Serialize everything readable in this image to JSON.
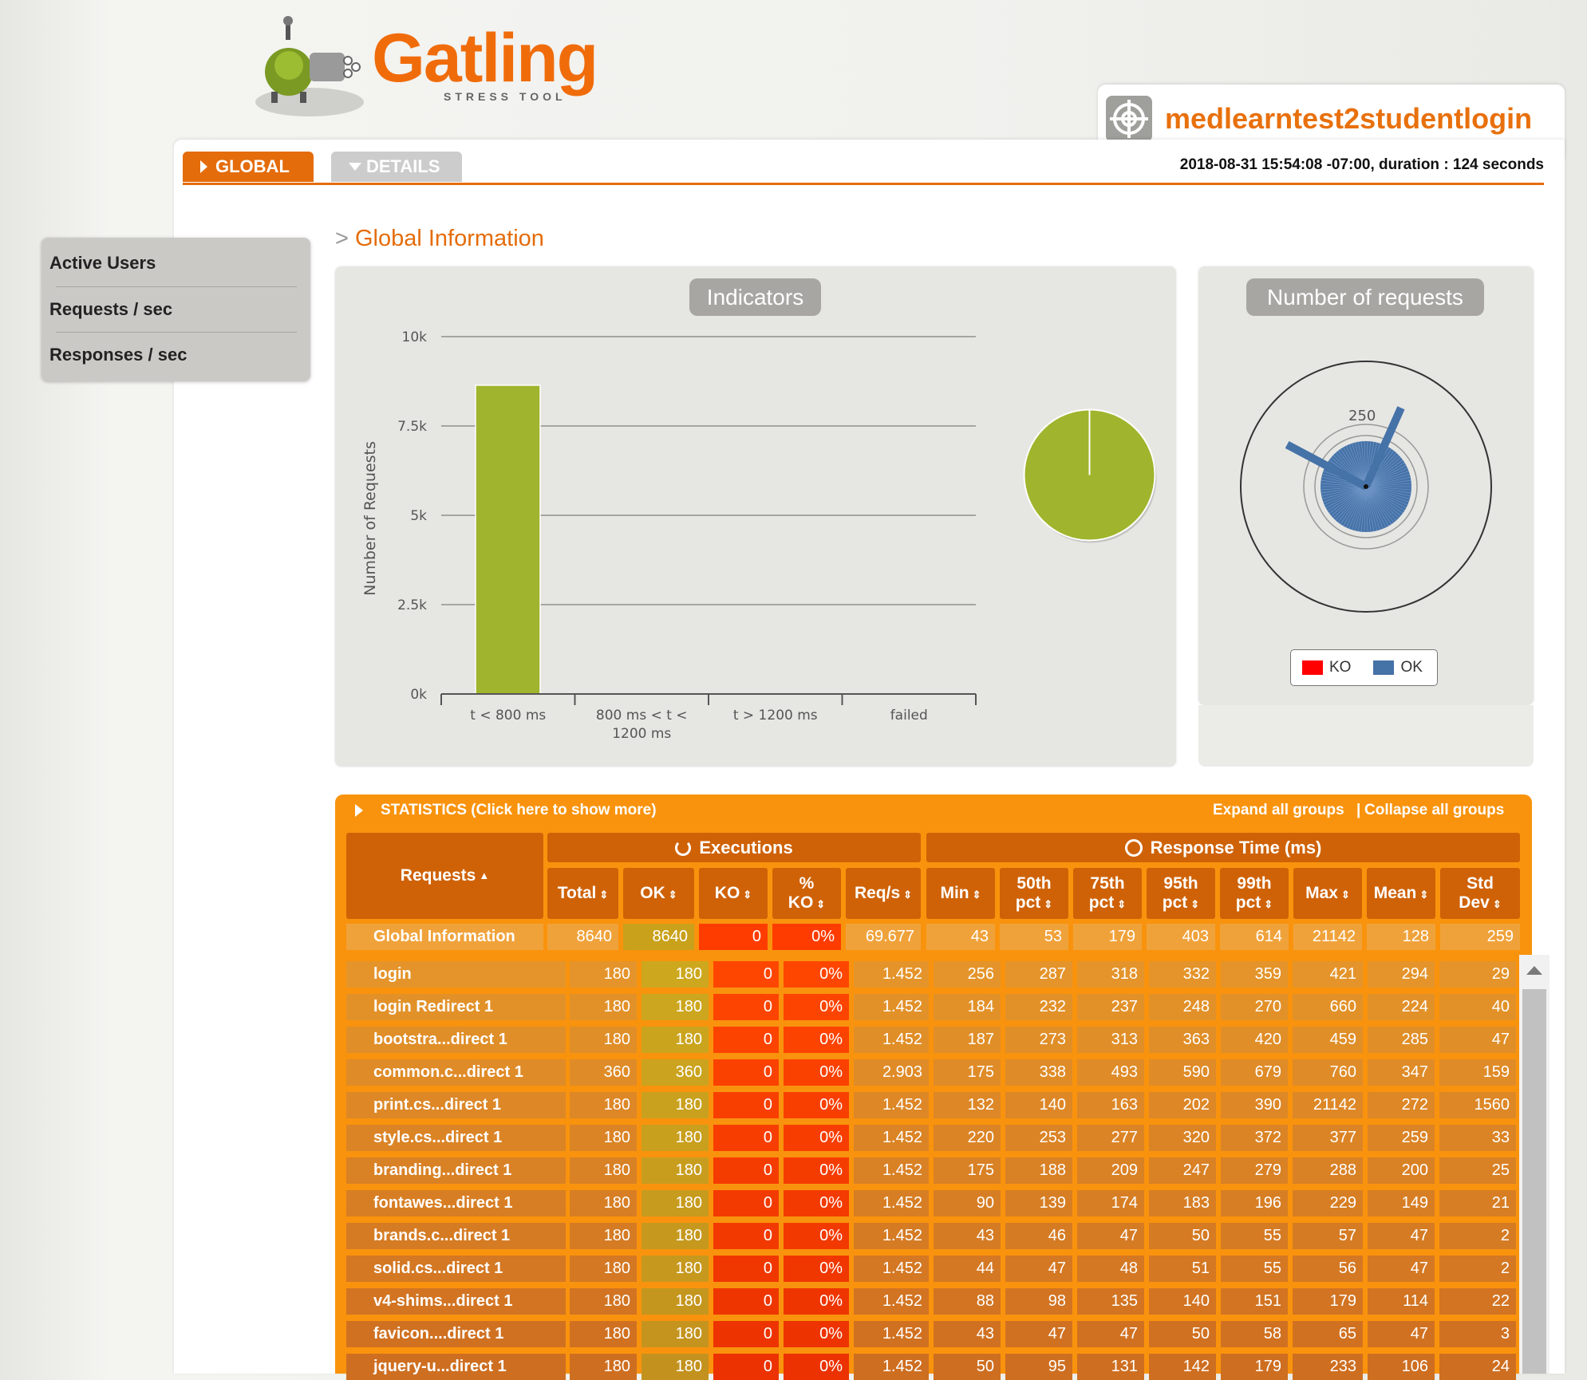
{
  "logo": {
    "word": "Gatling",
    "tagline": "STRESS TOOL"
  },
  "simulation": {
    "name": "medlearntest2studentlogin",
    "run_info": "2018-08-31 15:54:08 -07:00, duration : 124 seconds"
  },
  "tabs": {
    "global": "GLOBAL",
    "details": "DETAILS"
  },
  "menu": {
    "items": [
      "Active Users",
      "Requests / sec",
      "Responses / sec"
    ]
  },
  "section_title": "Global Information",
  "indicators": {
    "title": "Indicators",
    "chart_data": {
      "type": "bar",
      "categories": [
        "t < 800 ms",
        "800 ms < t < 1200 ms",
        "t > 1200 ms",
        "failed"
      ],
      "category_lines": [
        [
          "t < 800 ms"
        ],
        [
          "800 ms < t <",
          "1200 ms"
        ],
        [
          "t > 1200 ms"
        ],
        [
          "failed"
        ]
      ],
      "values": [
        8640,
        0,
        0,
        0
      ],
      "ylabel": "Number of Requests",
      "yticks": [
        "0k",
        "2.5k",
        "5k",
        "7.5k",
        "10k"
      ],
      "ylim": [
        0,
        10000
      ],
      "color": "#a0b52d",
      "grid": true
    },
    "pie": {
      "type": "pie",
      "slices": [
        {
          "label": "t < 800 ms",
          "value": 8640,
          "color": "#a0b52d"
        },
        {
          "label": "800 ms < t < 1200 ms",
          "value": 0,
          "color": "#f5d60a"
        },
        {
          "label": "t > 1200 ms",
          "value": 0,
          "color": "#ff9916"
        },
        {
          "label": "failed",
          "value": 0,
          "color": "#ff0000"
        }
      ]
    }
  },
  "requests_chart": {
    "title": "Number of requests",
    "ring_label": "250",
    "legend": [
      {
        "label": "KO",
        "color": "#ff0000"
      },
      {
        "label": "OK",
        "color": "#4572a7"
      }
    ]
  },
  "statistics": {
    "toggle_label": "STATISTICS (Click here to show more)",
    "expand_label": "Expand all groups",
    "separator": "|",
    "collapse_label": "Collapse all groups",
    "groups": {
      "executions": "Executions",
      "response_time": "Response Time (ms)"
    },
    "headers": {
      "requests": "Requests",
      "total": "Total",
      "ok": "OK",
      "ko": "KO",
      "pct_ko_1": "%",
      "pct_ko_2": "KO",
      "reqs": "Req/s",
      "min": "Min",
      "p50_1": "50th",
      "p50_2": "pct",
      "p75_1": "75th",
      "p75_2": "pct",
      "p95_1": "95th",
      "p95_2": "pct",
      "p99_1": "99th",
      "p99_2": "pct",
      "max": "Max",
      "mean": "Mean",
      "std_1": "Std",
      "std_2": "Dev"
    },
    "global_row": [
      "Global Information",
      "8640",
      "8640",
      "0",
      "0%",
      "69.677",
      "43",
      "53",
      "179",
      "403",
      "614",
      "21142",
      "128",
      "259"
    ],
    "rows": [
      [
        "login",
        "180",
        "180",
        "0",
        "0%",
        "1.452",
        "256",
        "287",
        "318",
        "332",
        "359",
        "421",
        "294",
        "29"
      ],
      [
        "login Redirect 1",
        "180",
        "180",
        "0",
        "0%",
        "1.452",
        "184",
        "232",
        "237",
        "248",
        "270",
        "660",
        "224",
        "40"
      ],
      [
        "bootstra...direct 1",
        "180",
        "180",
        "0",
        "0%",
        "1.452",
        "187",
        "273",
        "313",
        "363",
        "420",
        "459",
        "285",
        "47"
      ],
      [
        "common.c...direct 1",
        "360",
        "360",
        "0",
        "0%",
        "2.903",
        "175",
        "338",
        "493",
        "590",
        "679",
        "760",
        "347",
        "159"
      ],
      [
        "print.cs...direct 1",
        "180",
        "180",
        "0",
        "0%",
        "1.452",
        "132",
        "140",
        "163",
        "202",
        "390",
        "21142",
        "272",
        "1560"
      ],
      [
        "style.cs...direct 1",
        "180",
        "180",
        "0",
        "0%",
        "1.452",
        "220",
        "253",
        "277",
        "320",
        "372",
        "377",
        "259",
        "33"
      ],
      [
        "branding...direct 1",
        "180",
        "180",
        "0",
        "0%",
        "1.452",
        "175",
        "188",
        "209",
        "247",
        "279",
        "288",
        "200",
        "25"
      ],
      [
        "fontawes...direct 1",
        "180",
        "180",
        "0",
        "0%",
        "1.452",
        "90",
        "139",
        "174",
        "183",
        "196",
        "229",
        "149",
        "21"
      ],
      [
        "brands.c...direct 1",
        "180",
        "180",
        "0",
        "0%",
        "1.452",
        "43",
        "46",
        "47",
        "50",
        "55",
        "57",
        "47",
        "2"
      ],
      [
        "solid.cs...direct 1",
        "180",
        "180",
        "0",
        "0%",
        "1.452",
        "44",
        "47",
        "48",
        "51",
        "55",
        "56",
        "47",
        "2"
      ],
      [
        "v4-shims...direct 1",
        "180",
        "180",
        "0",
        "0%",
        "1.452",
        "88",
        "98",
        "135",
        "140",
        "151",
        "179",
        "114",
        "22"
      ],
      [
        "favicon....direct 1",
        "180",
        "180",
        "0",
        "0%",
        "1.452",
        "43",
        "47",
        "47",
        "50",
        "58",
        "65",
        "47",
        "3"
      ],
      [
        "jquery-u...direct 1",
        "180",
        "180",
        "0",
        "0%",
        "1.452",
        "50",
        "95",
        "131",
        "142",
        "179",
        "233",
        "106",
        "24"
      ]
    ]
  },
  "colors": {
    "accent": "#e46c0b",
    "ok_cell": "#c9a11b",
    "ko_cell": "#ff3c00",
    "table_bg": "#f9930d"
  }
}
